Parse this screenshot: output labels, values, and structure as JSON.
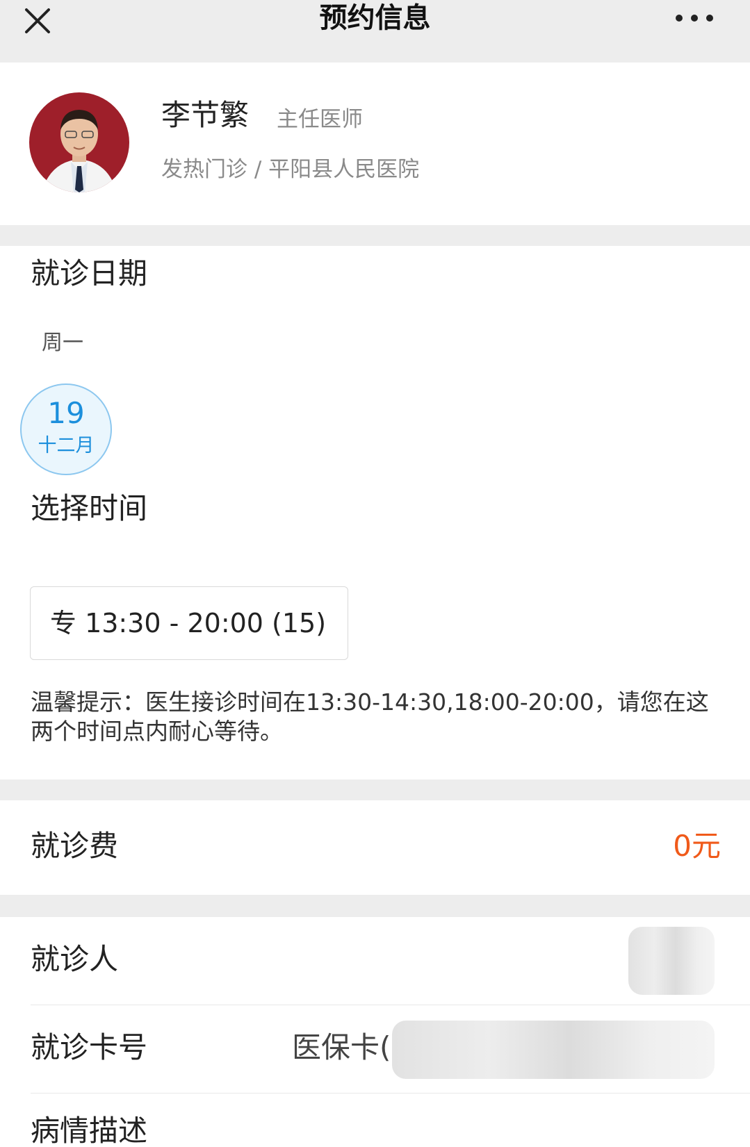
{
  "header": {
    "title": "预约信息",
    "close_icon": "close-icon",
    "more_icon": "more-dots-icon"
  },
  "doctor": {
    "name": "李节繁",
    "title": "主任医师",
    "department_line": "发热门诊 / 平阳县人民医院"
  },
  "date_section": {
    "title": "就诊日期",
    "weekday": "周一",
    "selected_date": {
      "day": "19",
      "month": "十二月"
    }
  },
  "time_section": {
    "title": "选择时间",
    "slots": [
      {
        "label": "专 13:30 - 20:00 (15)"
      }
    ],
    "tip": "温馨提示：医生接诊时间在13:30-14:30,18:00-20:00，请您在这两个时间点内耐心等待。"
  },
  "fee": {
    "label": "就诊费",
    "value": "0元"
  },
  "patient": {
    "patient_label": "就诊人",
    "card_label": "就诊卡号",
    "card_value_prefix": "医保卡(",
    "description_label": "病情描述"
  },
  "colors": {
    "accent_blue": "#1c8fdc",
    "fee_orange": "#f05a1a",
    "bg_gray": "#ededed"
  }
}
